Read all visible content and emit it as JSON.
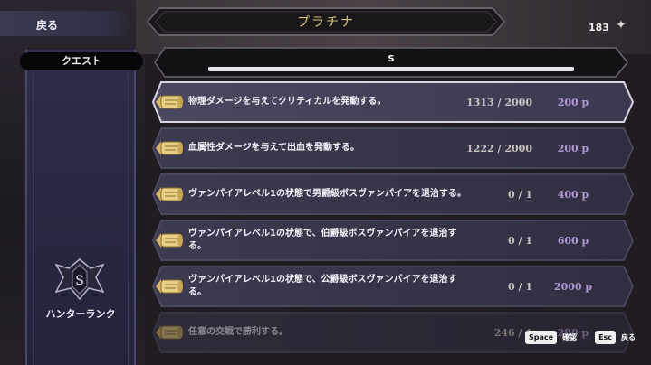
{
  "nav": {
    "back_label": "戻る"
  },
  "sidebar": {
    "quest_label": "クエスト",
    "rank_letter": "S",
    "rank_label": "ハンターランク"
  },
  "header": {
    "title": "プラチナ",
    "count": "183",
    "count_icon": "coin-icon"
  },
  "rank_selector": {
    "rank": "S"
  },
  "quests": [
    {
      "title": "物理ダメージを与えてクリティカルを発動する。",
      "progress": "1313 / 2000",
      "reward": "200 p",
      "selected": true
    },
    {
      "title": "血属性ダメージを与えて出血を発動する。",
      "progress": "1222 / 2000",
      "reward": "200 p"
    },
    {
      "title": "ヴァンパイアレベル1の状態で男爵級ボスヴァンパイアを退治する。",
      "progress": "0 / 1",
      "reward": "400 p"
    },
    {
      "title": "ヴァンパイアレベル1の状態で、伯爵級ボスヴァンパイアを退治する。",
      "progress": "0 / 1",
      "reward": "600 p"
    },
    {
      "title": "ヴァンパイアレベル1の状態で、公爵級ボスヴァンパイアを退治する。",
      "progress": "0 / 1",
      "reward": "2000 p"
    },
    {
      "title": "任意の交戦で勝利する。",
      "progress": "246 / 1",
      "reward": "280 p",
      "dim": true
    }
  ],
  "footer": {
    "confirm_key": "Space",
    "confirm_label": "確認",
    "back_key": "Esc",
    "back_label": "戻る"
  },
  "colors": {
    "accent_gold": "#d9c57a",
    "reward_purple": "#b39bd8",
    "banner_blue": "#2d2c4a"
  }
}
